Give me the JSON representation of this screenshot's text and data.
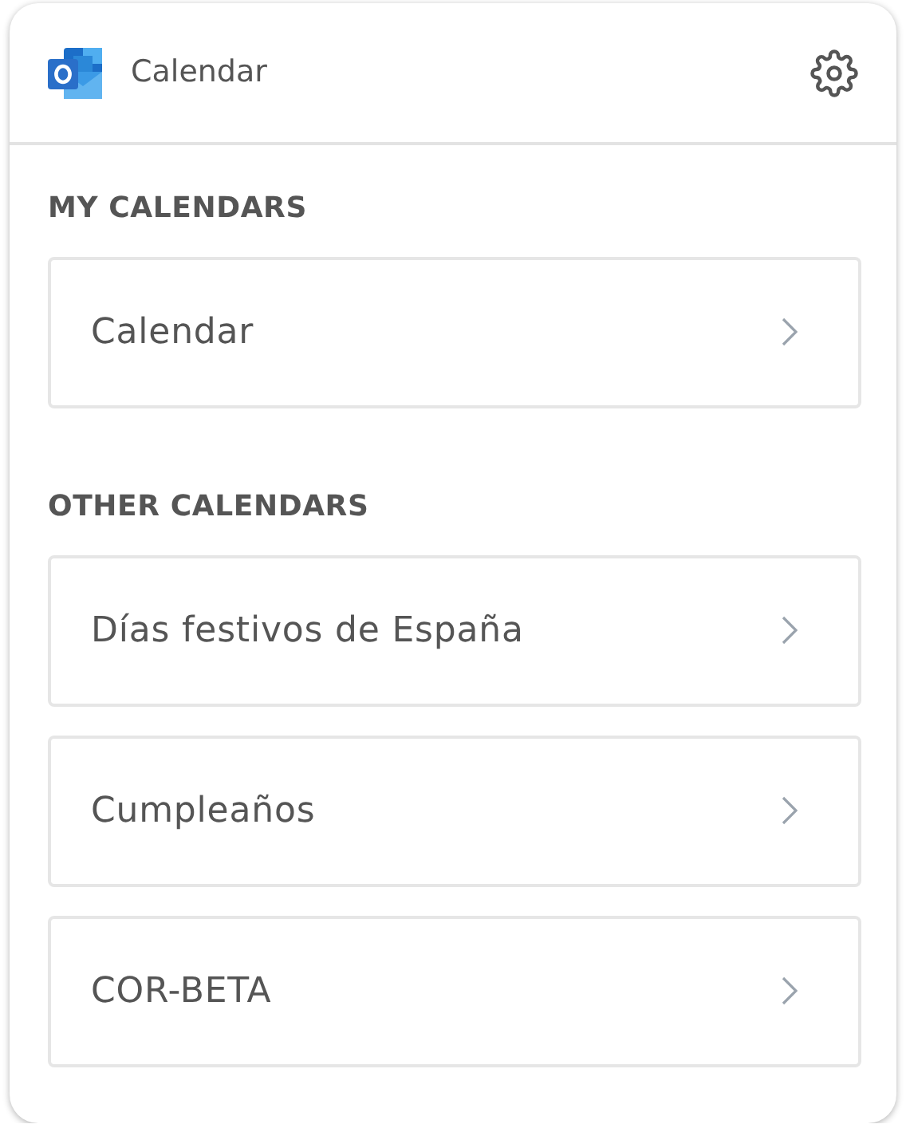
{
  "header": {
    "title": "Calendar"
  },
  "sections": [
    {
      "title": "MY CALENDARS",
      "items": [
        {
          "label": "Calendar"
        }
      ]
    },
    {
      "title": "OTHER CALENDARS",
      "items": [
        {
          "label": "Días festivos de España"
        },
        {
          "label": "Cumpleaños"
        },
        {
          "label": "COR-BETA"
        }
      ]
    }
  ]
}
